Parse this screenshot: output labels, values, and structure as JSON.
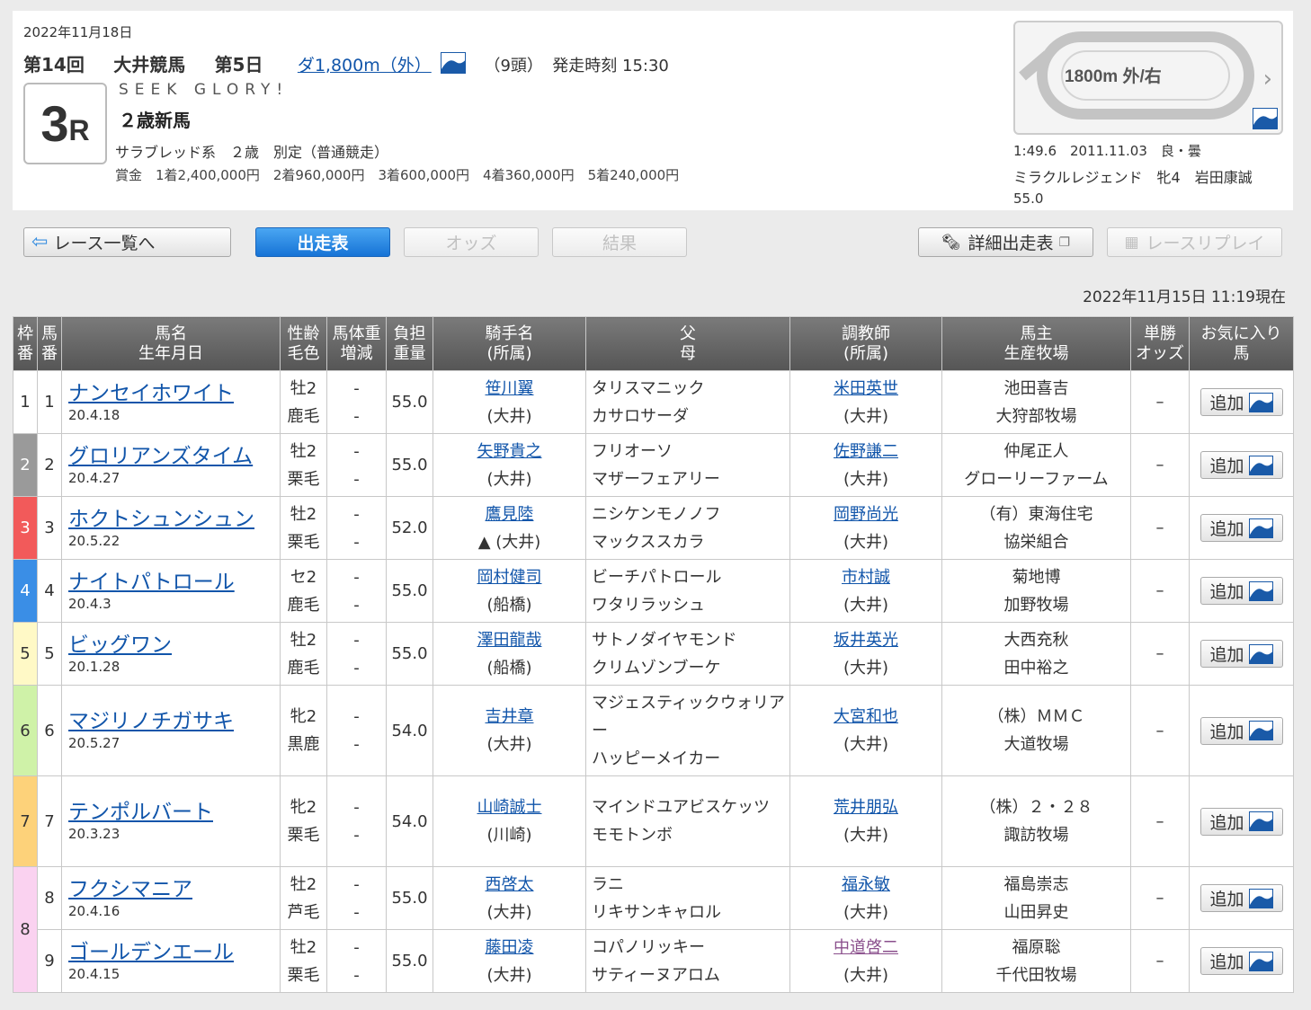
{
  "race": {
    "date": "2022年11月18日",
    "kai": "第14回",
    "venue": "大井競馬",
    "day": "第5日",
    "distance": "ダ1,800m（外）",
    "heads": "（9頭）",
    "start": "発走時刻 15:30",
    "race_no": "3",
    "race_no_suffix": "R",
    "name_en": "SEEK GLORY!",
    "name": "２歳新馬",
    "condition": "サラブレッド系　２歳　別定（普通競走）",
    "prize": "賞金　1着2,400,000円　2着960,000円　3着600,000円　4着360,000円　5着240,000円"
  },
  "course": {
    "label": "1800m 外/右",
    "record_time": "1:49.6　2011.11.03　良・曇",
    "record_horse": "ミラクルレジェンド　牝4　岩田康誠",
    "record_weight": "55.0"
  },
  "nav": {
    "back": "レース一覧へ",
    "entry": "出走表",
    "odds": "オッズ",
    "result": "結果",
    "detail": "詳細出走表",
    "replay": "レースリプレイ"
  },
  "updated": "2022年11月15日 11:19現在",
  "headers": {
    "waku": "枠\n番",
    "umaban": "馬\n番",
    "horse": "馬名\n生年月日",
    "sex": "性齢\n毛色",
    "bw": "馬体重\n増減",
    "wt": "負担\n重量",
    "jockey": "騎手名\n(所属)",
    "sire": "父\n母",
    "trainer": "調教師\n(所属)",
    "owner": "馬主\n生産牧場",
    "odds": "単勝\nオッズ",
    "fav": "お気に入り\n馬"
  },
  "entries": [
    {
      "waku": "1",
      "num": "1",
      "name": "ナンセイホワイト",
      "born": "20.4.18",
      "sex": "牡2",
      "color": "鹿毛",
      "bw": "-",
      "bwd": "-",
      "weight": "55.0",
      "jockey": "笹川翼",
      "jaff": "(大井)",
      "sire": "タリスマニック",
      "dam": "カサロサーダ",
      "trainer": "米田英世",
      "taff": "(大井)",
      "owner": "池田喜吉",
      "breeder": "大狩部牧場",
      "odds": "–",
      "add": "追加"
    },
    {
      "waku": "2",
      "num": "2",
      "name": "グロリアンズタイム",
      "born": "20.4.27",
      "sex": "牡2",
      "color": "栗毛",
      "bw": "-",
      "bwd": "-",
      "weight": "55.0",
      "jockey": "矢野貴之",
      "jaff": "(大井)",
      "sire": "フリオーソ",
      "dam": "マザーフェアリー",
      "trainer": "佐野謙二",
      "taff": "(大井)",
      "owner": "仲尾正人",
      "breeder": "グローリーファーム",
      "odds": "–",
      "add": "追加"
    },
    {
      "waku": "3",
      "num": "3",
      "name": "ホクトシュンシュン",
      "born": "20.5.22",
      "sex": "牡2",
      "color": "栗毛",
      "bw": "-",
      "bwd": "-",
      "weight": "52.0",
      "jockey": "鷹見陸",
      "jaff": "▲ (大井)",
      "sire": "ニシケンモノノフ",
      "dam": "マックススカラ",
      "trainer": "岡野尚光",
      "taff": "(大井)",
      "owner": "（有）東海住宅",
      "breeder": "協栄組合",
      "odds": "–",
      "add": "追加"
    },
    {
      "waku": "4",
      "num": "4",
      "name": "ナイトパトロール",
      "born": "20.4.3",
      "sex": "セ2",
      "color": "鹿毛",
      "bw": "-",
      "bwd": "-",
      "weight": "55.0",
      "jockey": "岡村健司",
      "jaff": "(船橋)",
      "sire": "ビーチパトロール",
      "dam": "ワタリラッシュ",
      "trainer": "市村誠",
      "taff": "(大井)",
      "owner": "菊地博",
      "breeder": "加野牧場",
      "odds": "–",
      "add": "追加"
    },
    {
      "waku": "5",
      "num": "5",
      "name": "ビッグワン",
      "born": "20.1.28",
      "sex": "牡2",
      "color": "鹿毛",
      "bw": "-",
      "bwd": "-",
      "weight": "55.0",
      "jockey": "澤田龍哉",
      "jaff": "(船橋)",
      "sire": "サトノダイヤモンド",
      "dam": "クリムゾンブーケ",
      "trainer": "坂井英光",
      "taff": "(大井)",
      "owner": "大西充秋",
      "breeder": "田中裕之",
      "odds": "–",
      "add": "追加"
    },
    {
      "waku": "6",
      "num": "6",
      "name": "マジリノチガサキ",
      "born": "20.5.27",
      "sex": "牝2",
      "color": "黒鹿",
      "bw": "-",
      "bwd": "-",
      "weight": "54.0",
      "jockey": "吉井章",
      "jaff": "(大井)",
      "sire": "マジェスティックウォリアー",
      "dam": "ハッピーメイカー",
      "trainer": "大宮和也",
      "taff": "(大井)",
      "owner": "（株）ＭＭＣ",
      "breeder": "大道牧場",
      "odds": "–",
      "add": "追加"
    },
    {
      "waku": "7",
      "num": "7",
      "name": "テンポルバート",
      "born": "20.3.23",
      "sex": "牝2",
      "color": "栗毛",
      "bw": "-",
      "bwd": "-",
      "weight": "54.0",
      "jockey": "山崎誠士",
      "jaff": "(川崎)",
      "sire": "マインドユアビスケッツ",
      "dam": "モモトンボ",
      "trainer": "荒井朋弘",
      "taff": "(大井)",
      "owner": "（株）２・２８",
      "breeder": "諏訪牧場",
      "odds": "–",
      "add": "追加"
    },
    {
      "waku": "8",
      "num": "8",
      "name": "フクシマニア",
      "born": "20.4.16",
      "sex": "牡2",
      "color": "芦毛",
      "bw": "-",
      "bwd": "-",
      "weight": "55.0",
      "jockey": "西啓太",
      "jaff": "(大井)",
      "sire": "ラニ",
      "dam": "リキサンキャロル",
      "trainer": "福永敏",
      "taff": "(大井)",
      "owner": "福島崇志",
      "breeder": "山田昇史",
      "odds": "–",
      "add": "追加"
    },
    {
      "waku": "8",
      "num": "9",
      "name": "ゴールデンエール",
      "born": "20.4.15",
      "sex": "牡2",
      "color": "栗毛",
      "bw": "-",
      "bwd": "-",
      "weight": "55.0",
      "jockey": "藤田凌",
      "jaff": "(大井)",
      "sire": "コパノリッキー",
      "dam": "サティーヌアロム",
      "trainer": "中道啓二",
      "taff": "(大井)",
      "owner": "福原聡",
      "breeder": "千代田牧場",
      "odds": "–",
      "add": "追加"
    }
  ],
  "waku_colors": {
    "1": "#ffffff",
    "2": "#9a9a9a",
    "3": "#f25a5a",
    "4": "#3a8ee6",
    "5": "#fff9c6",
    "6": "#cff2a8",
    "7": "#fdd27a",
    "8": "#fad2f0"
  },
  "waku_text_colors": {
    "1": "#333333",
    "2": "#ffffff",
    "3": "#ffffff",
    "4": "#ffffff",
    "5": "#333333",
    "6": "#333333",
    "7": "#333333",
    "8": "#333333"
  },
  "icons": {
    "info": "wave-logo-icon",
    "back": "left-arrow-icon",
    "detail": "document-icon",
    "replay": "video-icon",
    "chevron": "chevron-right-icon"
  },
  "accent_color": "#1673d6",
  "link_color": "#1155aa"
}
